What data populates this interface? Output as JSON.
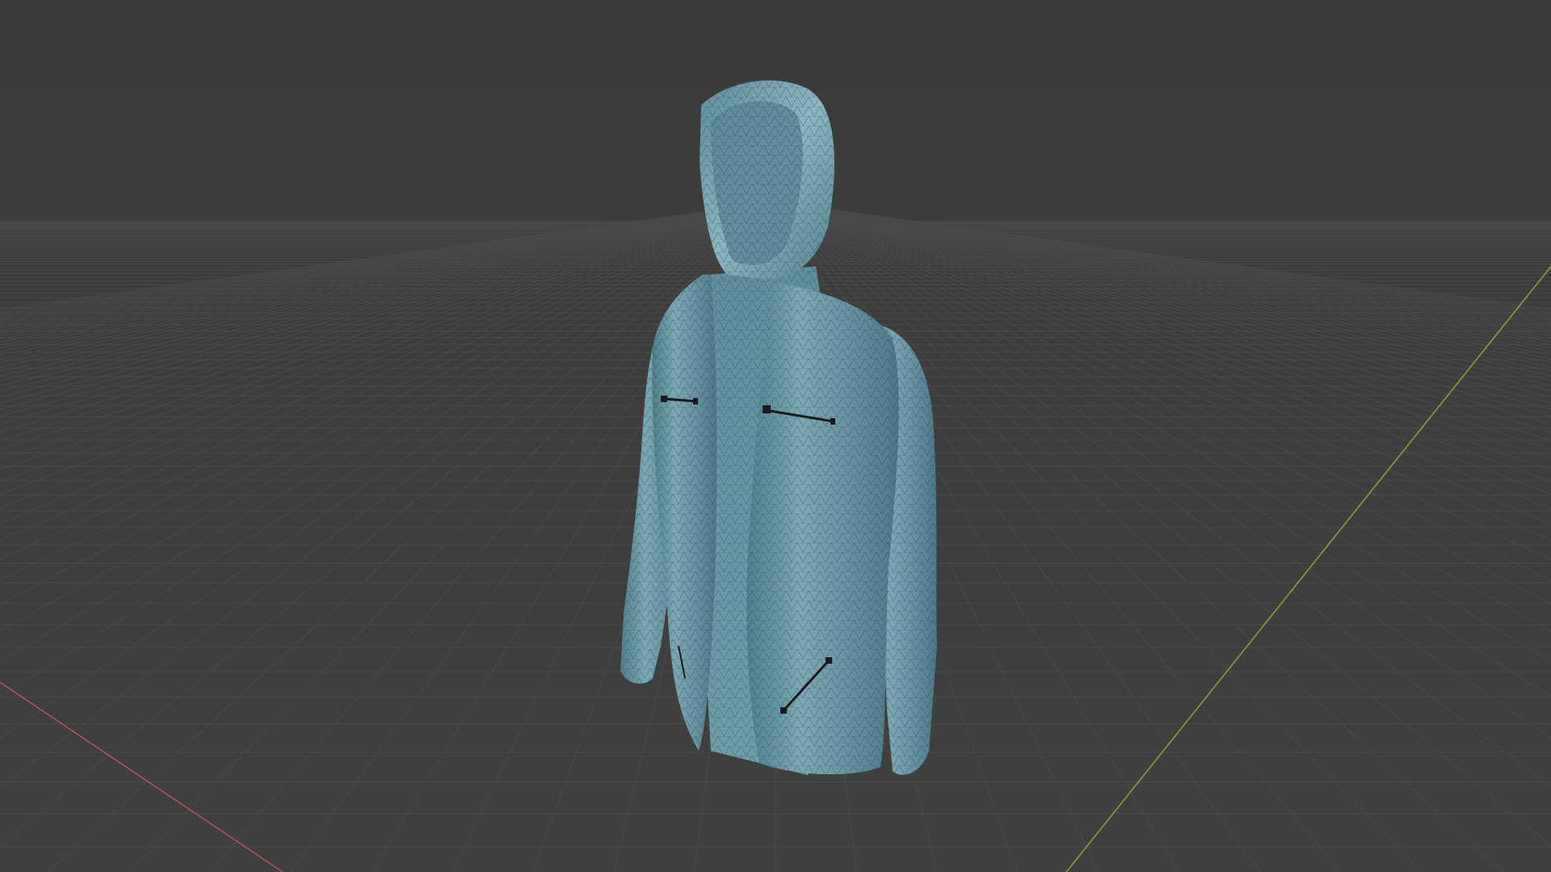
{
  "viewport": {
    "type": "3d-viewport",
    "background_color": "#3d3d3d",
    "grid_color": "#4a4a4a",
    "x_axis_color": "#b5525a",
    "y_axis_color": "#8aa13c",
    "object": {
      "name": "hoodie-mesh",
      "shading": "solid-with-wireframe",
      "base_color": "#6a98a6",
      "highlight_color": "#9cc4cf",
      "shadow_color": "#3e6672",
      "wire_color": "#2b3f46",
      "zipper_color": "#1a1a1a",
      "zippers": [
        "left-chest-zipper",
        "right-chest-zipper",
        "pocket-zipper"
      ]
    }
  }
}
